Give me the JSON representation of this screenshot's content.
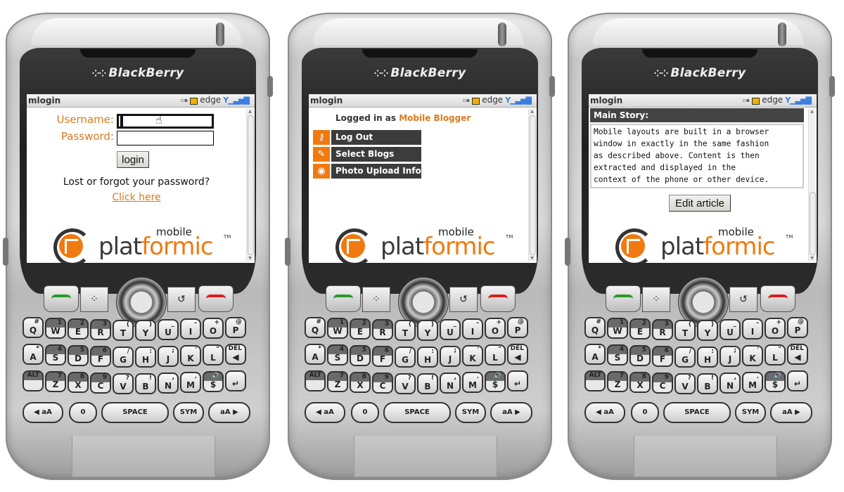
{
  "brand": "BlackBerry",
  "status_bar": {
    "network": "edge"
  },
  "screens": [
    {
      "title": "mlogin",
      "username_label": "Username:",
      "password_label": "Password:",
      "username_value": "",
      "password_value": "",
      "login_button": "login",
      "lost_text": "Lost or forgot your password?",
      "click_here": "Click here"
    },
    {
      "title": "mlogin",
      "logged_in_prefix": "Logged in as ",
      "logged_in_user": "Mobile Blogger",
      "menu": [
        {
          "icon": "key-icon",
          "label": "Log Out"
        },
        {
          "icon": "pen-icon",
          "label": "Select Blogs"
        },
        {
          "icon": "camera-icon",
          "label": "Photo Upload Info"
        }
      ]
    },
    {
      "title": "mlogin",
      "story_heading": "Main Story:",
      "story_lines": [
        "Mobile layouts are built in a browser",
        "window in exactly in the same fashion",
        "as described above. Content is then",
        "extracted and displayed in the",
        "context of the phone or other device."
      ],
      "edit_button": "Edit article"
    }
  ],
  "logo": {
    "mobile": "mobile",
    "plat": "plat",
    "formic": "formic",
    "tm": "TM"
  },
  "keyboard": {
    "rows": [
      [
        {
          "m": "Q",
          "s": "#"
        },
        {
          "m": "W",
          "s": "1",
          "d": true
        },
        {
          "m": "E",
          "s": "2",
          "d": true
        },
        {
          "m": "R",
          "s": "3",
          "d": true
        },
        {
          "m": "T",
          "s": "("
        },
        {
          "m": "Y",
          "s": ")"
        },
        {
          "m": "U",
          "s": "_"
        },
        {
          "m": "I",
          "s": "-"
        },
        {
          "m": "O",
          "s": "+"
        },
        {
          "m": "P",
          "s": "@"
        }
      ],
      [
        {
          "m": "A",
          "s": "*"
        },
        {
          "m": "S",
          "s": "4",
          "d": true
        },
        {
          "m": "D",
          "s": "5",
          "d": true
        },
        {
          "m": "F",
          "s": "6",
          "d": true
        },
        {
          "m": "G",
          "s": "/"
        },
        {
          "m": "H",
          "s": ":"
        },
        {
          "m": "J",
          "s": ";"
        },
        {
          "m": "K",
          "s": "'"
        },
        {
          "m": "L",
          "s": "\""
        },
        {
          "m": "◀",
          "s": "DEL"
        }
      ],
      [
        {
          "m": "",
          "s": "ALT",
          "d": true
        },
        {
          "m": "Z",
          "s": "7",
          "d": true
        },
        {
          "m": "X",
          "s": "8",
          "d": true
        },
        {
          "m": "C",
          "s": "9",
          "d": true
        },
        {
          "m": "V",
          "s": "?"
        },
        {
          "m": "B",
          "s": "!"
        },
        {
          "m": "N",
          "s": ","
        },
        {
          "m": "M",
          "s": "."
        },
        {
          "m": "$",
          "s": "🔊",
          "d": true
        },
        {
          "m": "↵",
          "s": ""
        }
      ]
    ],
    "bottom": {
      "shift_left": "◀ aA",
      "zero": "0",
      "space": "SPACE",
      "sym": "SYM",
      "shift_right": "aA ▶"
    }
  },
  "colors": {
    "accent": "#f07a10",
    "label_orange": "#d97a1e",
    "menu_dark": "#3c3c3c"
  }
}
